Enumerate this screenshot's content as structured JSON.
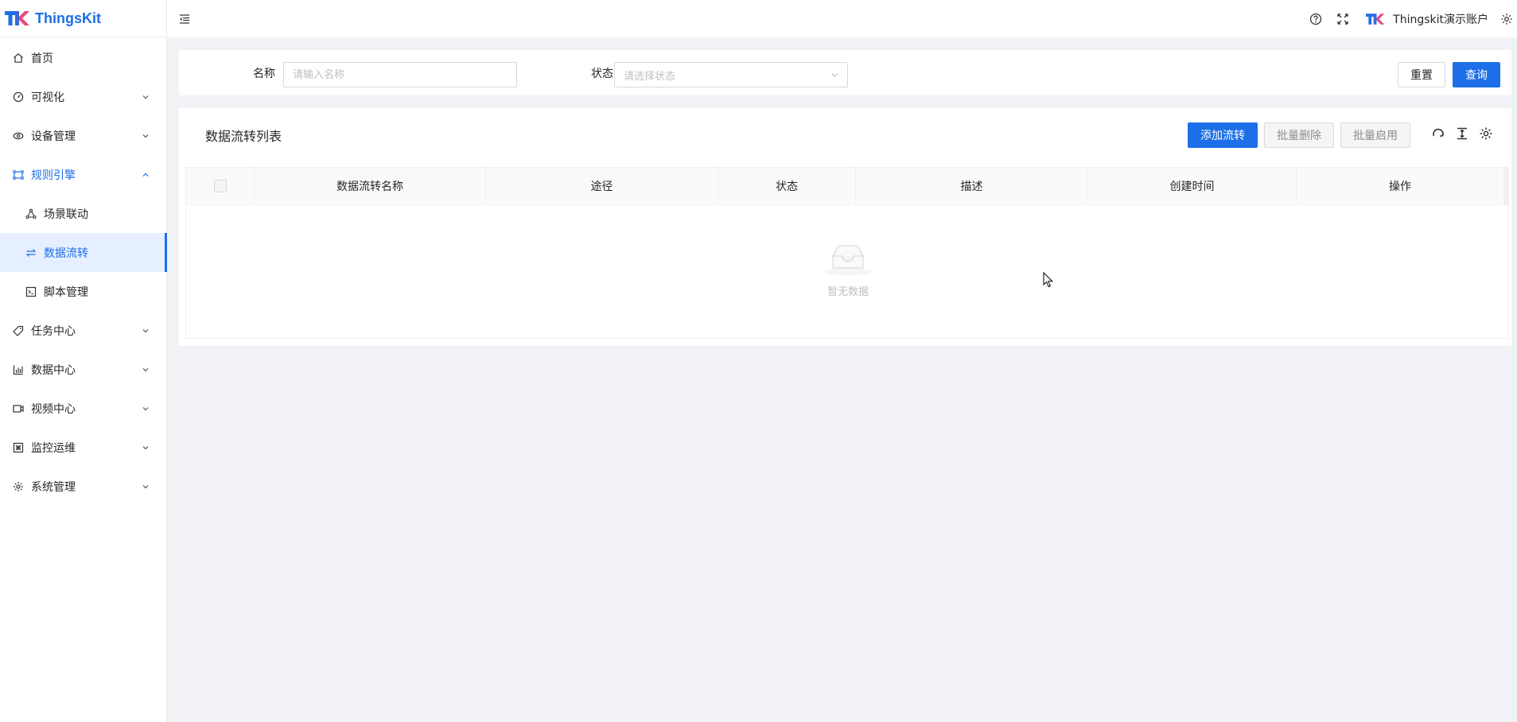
{
  "app": {
    "brand": "ThingsKit",
    "brand_color": "#1c6fe8"
  },
  "sidebar": {
    "items": [
      {
        "label": "首页",
        "icon": "home-icon"
      },
      {
        "label": "可视化",
        "icon": "dashboard-icon"
      },
      {
        "label": "设备管理",
        "icon": "device-icon"
      },
      {
        "label": "规则引擎",
        "icon": "rule-engine-icon",
        "expanded": true
      },
      {
        "label": "场景联动",
        "icon": "scene-link-icon",
        "sub": true
      },
      {
        "label": "数据流转",
        "icon": "data-flow-icon",
        "sub": true,
        "active": true
      },
      {
        "label": "脚本管理",
        "icon": "script-icon",
        "sub": true
      },
      {
        "label": "任务中心",
        "icon": "task-icon"
      },
      {
        "label": "数据中心",
        "icon": "bar-chart-icon"
      },
      {
        "label": "视频中心",
        "icon": "video-icon"
      },
      {
        "label": "监控运维",
        "icon": "monitor-icon"
      },
      {
        "label": "系统管理",
        "icon": "gear-icon"
      }
    ]
  },
  "header": {
    "user_name": "Thingskit演示账户"
  },
  "search": {
    "name_label": "名称",
    "name_placeholder": "请输入名称",
    "status_label": "状态",
    "status_placeholder": "请选择状态",
    "reset_label": "重置",
    "query_label": "查询"
  },
  "table": {
    "title": "数据流转列表",
    "add_label": "添加流转",
    "batch_delete_label": "批量删除",
    "batch_enable_label": "批量启用",
    "columns": [
      "数据流转名称",
      "途径",
      "状态",
      "描述",
      "创建时间",
      "操作"
    ],
    "empty_text": "暂无数据"
  }
}
